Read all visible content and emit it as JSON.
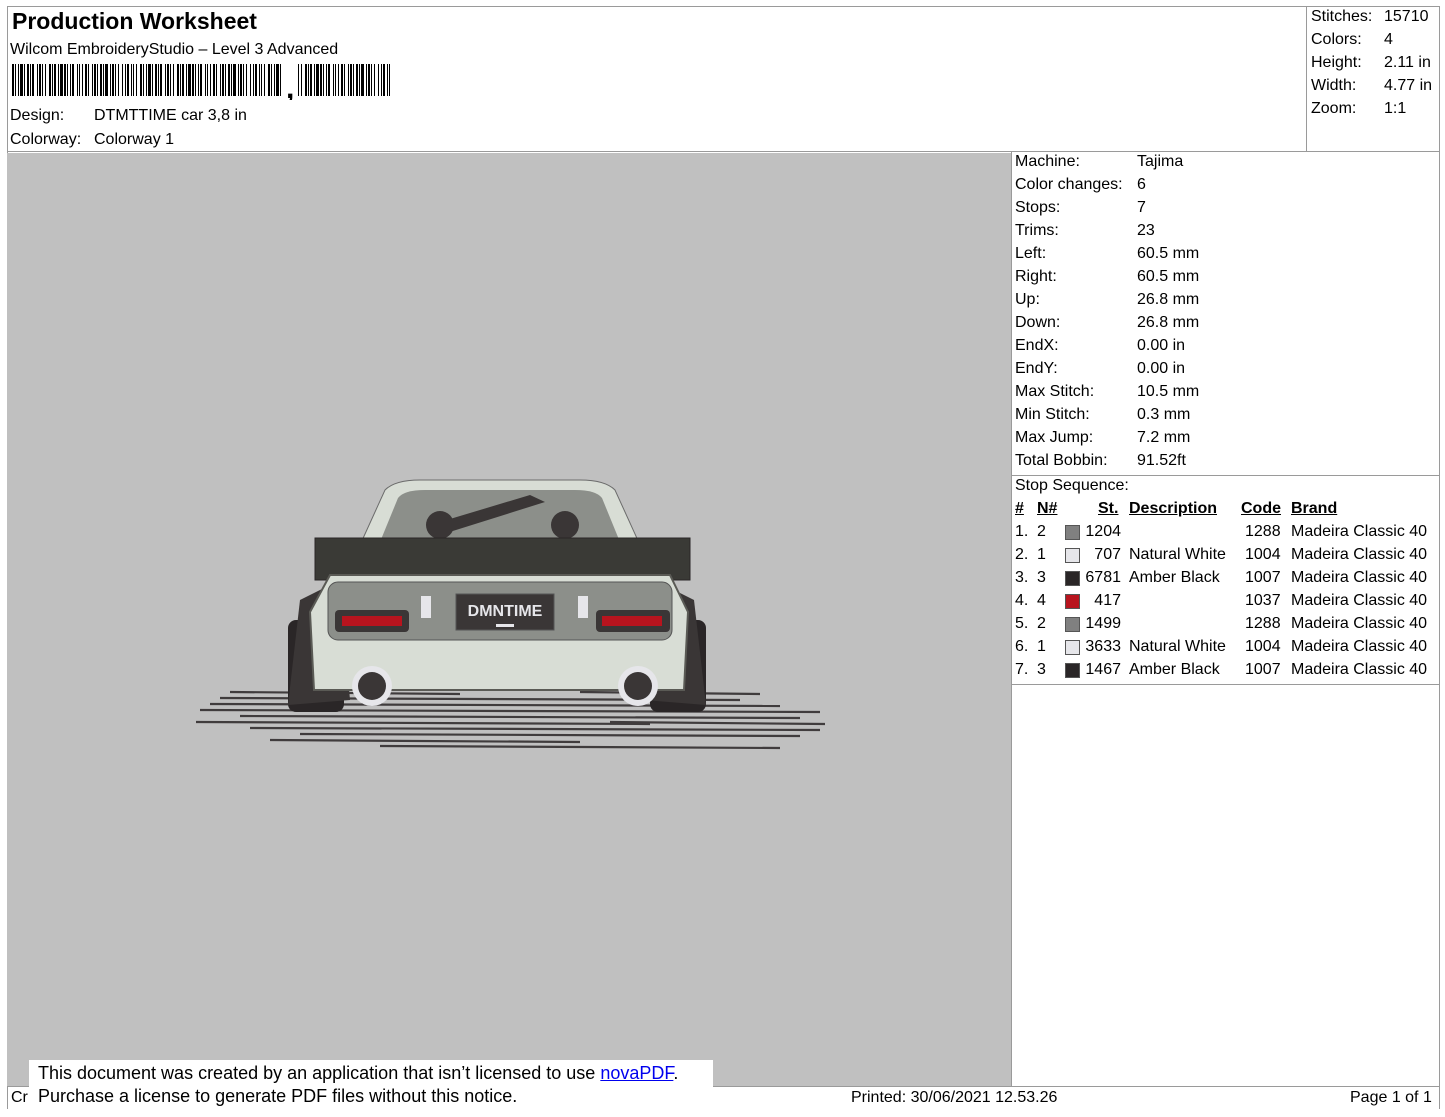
{
  "header": {
    "title": "Production Worksheet",
    "software": "Wilcom EmbroideryStudio – Level 3 Advanced",
    "barcode_text": ",",
    "design_label": "Design:",
    "design_value": "DTMTTIME car 3,8 in",
    "colorway_label": "Colorway:",
    "colorway_value": "Colorway 1"
  },
  "summary": {
    "stitches_label": "Stitches:",
    "stitches_value": "15710",
    "colors_label": "Colors:",
    "colors_value": "4",
    "height_label": "Height:",
    "height_value": "2.11 in",
    "width_label": "Width:",
    "width_value": "4.77 in",
    "zoom_label": "Zoom:",
    "zoom_value": "1:1"
  },
  "preview": {
    "plate_text": "DMNTIME"
  },
  "machine_info": [
    {
      "label": "Machine:",
      "value": "Tajima"
    },
    {
      "label": "Color changes:",
      "value": "6"
    },
    {
      "label": "Stops:",
      "value": "7"
    },
    {
      "label": "Trims:",
      "value": "23"
    },
    {
      "label": "Left:",
      "value": "60.5 mm"
    },
    {
      "label": "Right:",
      "value": "60.5 mm"
    },
    {
      "label": "Up:",
      "value": "26.8 mm"
    },
    {
      "label": "Down:",
      "value": "26.8 mm"
    },
    {
      "label": "EndX:",
      "value": "0.00 in"
    },
    {
      "label": "EndY:",
      "value": "0.00 in"
    },
    {
      "label": "Max Stitch:",
      "value": "10.5 mm"
    },
    {
      "label": "Min Stitch:",
      "value": "0.3 mm"
    },
    {
      "label": "Max Jump:",
      "value": "7.2 mm"
    },
    {
      "label": "Total Bobbin:",
      "value": "91.52ft"
    }
  ],
  "stop_sequence": {
    "title": "Stop Sequence:",
    "headers": {
      "num": "#",
      "needle": "N#",
      "stitches": "St.",
      "description": "Description",
      "code": "Code",
      "brand": "Brand"
    },
    "rows": [
      {
        "num": "1.",
        "needle": "2",
        "color": "#808080",
        "stitches": "1204",
        "description": "",
        "code": "1288",
        "brand": "Madeira Classic 40"
      },
      {
        "num": "2.",
        "needle": "1",
        "color": "#e6e6ea",
        "stitches": "707",
        "description": "Natural White",
        "code": "1004",
        "brand": "Madeira Classic 40"
      },
      {
        "num": "3.",
        "needle": "3",
        "color": "#2a2627",
        "stitches": "6781",
        "description": "Amber Black",
        "code": "1007",
        "brand": "Madeira Classic 40"
      },
      {
        "num": "4.",
        "needle": "4",
        "color": "#b8141e",
        "stitches": "417",
        "description": "",
        "code": "1037",
        "brand": "Madeira Classic 40"
      },
      {
        "num": "5.",
        "needle": "2",
        "color": "#808080",
        "stitches": "1499",
        "description": "",
        "code": "1288",
        "brand": "Madeira Classic 40"
      },
      {
        "num": "6.",
        "needle": "1",
        "color": "#e6e6ea",
        "stitches": "3633",
        "description": "Natural White",
        "code": "1004",
        "brand": "Madeira Classic 40"
      },
      {
        "num": "7.",
        "needle": "3",
        "color": "#2a2627",
        "stitches": "1467",
        "description": "Amber Black",
        "code": "1007",
        "brand": "Madeira Classic 40"
      }
    ]
  },
  "notice": {
    "line1_prefix": "This document was created by an application that isn’t licensed to use ",
    "link_text": "novaPDF",
    "line1_suffix": ".",
    "line2": "Purchase a license to generate PDF files without this notice."
  },
  "footer": {
    "left_fragment": "Cr",
    "printed": "Printed: 30/06/2021 12.53.26",
    "page": "Page 1 of 1"
  }
}
